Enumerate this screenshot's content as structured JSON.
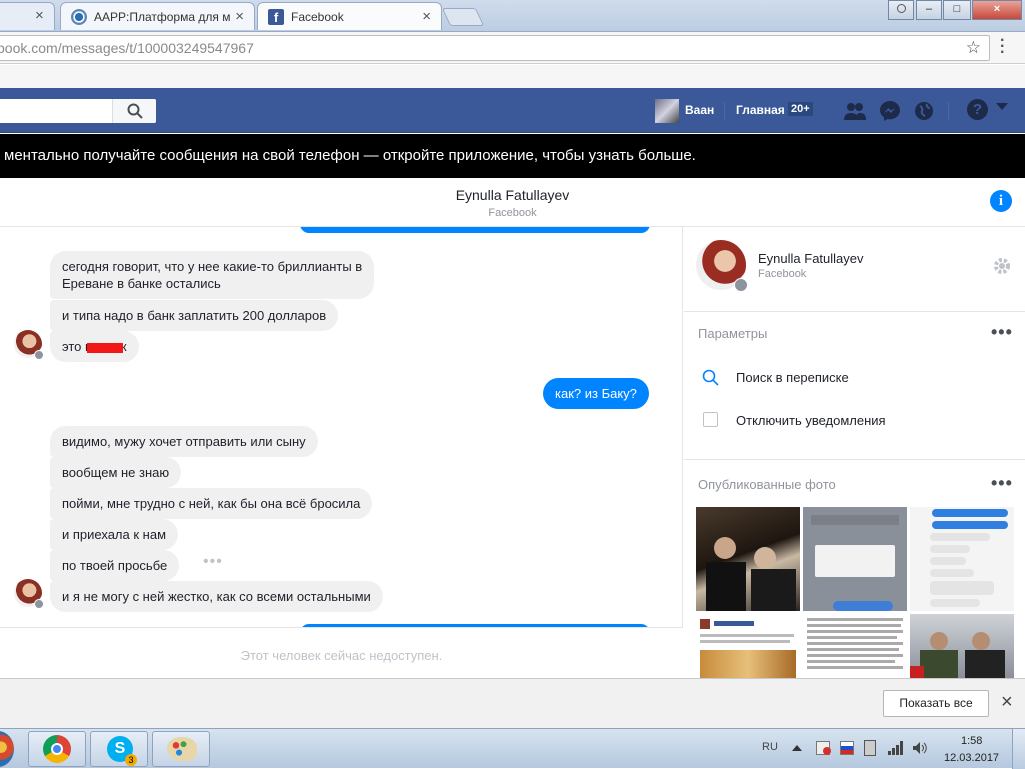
{
  "browser": {
    "tabs": [
      {
        "title": "AAPP:Платформа для м",
        "close": "×"
      },
      {
        "title": "Facebook",
        "close": "×"
      }
    ],
    "window_buttons": {
      "minimize": "–",
      "maximize": "□",
      "close": "×"
    },
    "url": {
      "host_dim_prefix": "book.com",
      "path": "/messages/t/100003249547967"
    }
  },
  "fb_header": {
    "search_placeholder": "",
    "user_name": "Ваан",
    "home_label": "Главная",
    "home_badge": "20+",
    "help_label": "?"
  },
  "notice": "ментально получайте сообщения на свой телефон — откройте приложение, чтобы узнать больше.",
  "conversation": {
    "name": "Eynulla Fatullayev",
    "subtitle": "Facebook",
    "info_label": "i"
  },
  "messages": [
    {
      "text": "сегодня говорит, что у нее какие-то бриллианты в",
      "text2": "Ереване в банке остались"
    },
    {
      "text": "и типа надо в банк заплатить 200 долларов"
    },
    {
      "text": "это п        к"
    },
    {
      "text": "как? из Баку?"
    },
    {
      "text": "видимо, мужу хочет отправить или сыну"
    },
    {
      "text": "вообщем не знаю"
    },
    {
      "text": "пойми, мне трудно с ней, как бы она всё бросила"
    },
    {
      "text": "и приехала к нам"
    },
    {
      "text": "по твоей просьбе"
    },
    {
      "text": "и я не могу с ней жестко, как со всеми остальными"
    }
  ],
  "composer_placeholder": "Этот человек сейчас недоступен.",
  "side": {
    "name": "Eynulla Fatullayev",
    "subtitle": "Facebook",
    "params_title": "Параметры",
    "search_label": "Поиск в переписке",
    "mute_label": "Отключить уведомления",
    "photos_title": "Опубликованные фото",
    "more": "•••"
  },
  "downloads": {
    "show_all": "Показать все",
    "close": "×"
  },
  "taskbar": {
    "skype_badge": "3",
    "lang": "RU",
    "time": "1:58",
    "date": "12.03.2017"
  },
  "colors": {
    "fb_blue": "#3b5998",
    "messenger_blue": "#0084ff",
    "bubble_gray": "#f1f0f0"
  }
}
